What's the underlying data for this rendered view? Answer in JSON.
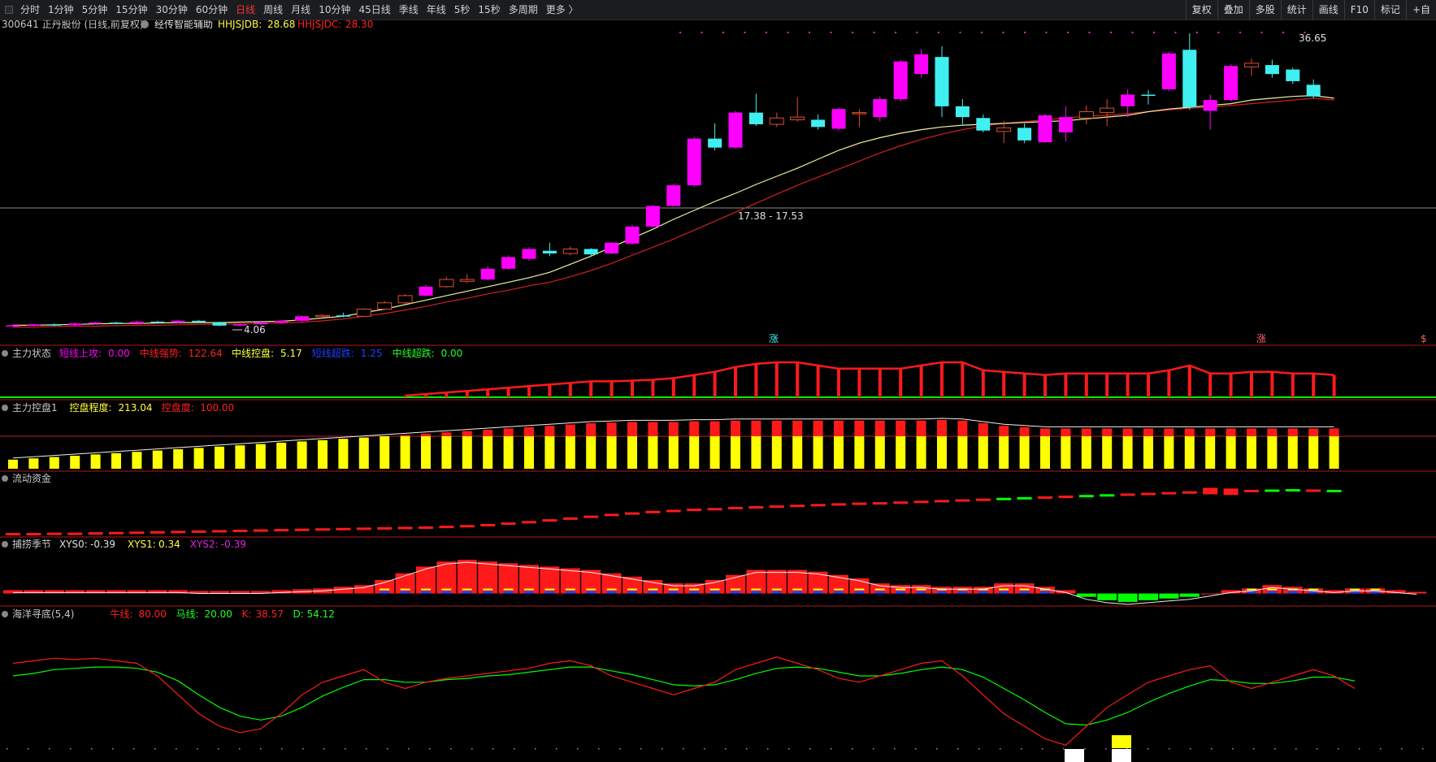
{
  "toolbar": {
    "periods": [
      "分时",
      "1分钟",
      "5分钟",
      "15分钟",
      "30分钟",
      "60分钟",
      "日线",
      "周线",
      "月线",
      "10分钟",
      "45日线",
      "季线",
      "年线",
      "5秒",
      "15秒",
      "多周期",
      "更多 〉"
    ],
    "active": "日线",
    "right_buttons": [
      "复权",
      "叠加",
      "多股",
      "统计",
      "画线",
      "F10",
      "标记",
      "+自"
    ]
  },
  "header": {
    "stock": "300641 正丹股份 (日线,前复权)",
    "indicator": "经传智能辅助",
    "hh_label": "HHJSJDB:",
    "hh_value": "28.68",
    "hc_label": "HHJSJDC:",
    "hc_value": "28.30"
  },
  "colors": {
    "up": "#ff00ff",
    "down": "#40f0f0",
    "ma1": "#f0f0a0",
    "ma2": "#d02020",
    "red": "#ff1a1a",
    "yellow": "#ffff00",
    "green": "#00ff00",
    "magenta": "#e020e0",
    "blue": "#2040ff",
    "white": "#ffffff"
  },
  "chart_data": [
    {
      "panel": "main",
      "type": "candlestick",
      "annotations": {
        "max_label": "36.65",
        "min_label": "4.06",
        "crosshair_label": "17.38 - 17.53",
        "markers": [
          "涨",
          "涨",
          "$"
        ]
      },
      "candles": [
        {
          "o": 4.0,
          "h": 4.2,
          "l": 3.9,
          "c": 4.1
        },
        {
          "o": 4.1,
          "h": 4.3,
          "l": 4.0,
          "c": 4.2
        },
        {
          "o": 4.2,
          "h": 4.3,
          "l": 4.0,
          "c": 4.1
        },
        {
          "o": 4.1,
          "h": 4.4,
          "l": 4.0,
          "c": 4.3
        },
        {
          "o": 4.3,
          "h": 4.5,
          "l": 4.2,
          "c": 4.4
        },
        {
          "o": 4.4,
          "h": 4.5,
          "l": 4.2,
          "c": 4.3
        },
        {
          "o": 4.3,
          "h": 4.6,
          "l": 4.2,
          "c": 4.5
        },
        {
          "o": 4.5,
          "h": 4.6,
          "l": 4.3,
          "c": 4.4
        },
        {
          "o": 4.4,
          "h": 4.7,
          "l": 4.3,
          "c": 4.6
        },
        {
          "o": 4.6,
          "h": 4.7,
          "l": 4.4,
          "c": 4.5
        },
        {
          "o": 4.4,
          "h": 4.5,
          "l": 4.0,
          "c": 4.06
        },
        {
          "o": 4.1,
          "h": 4.3,
          "l": 4.0,
          "c": 4.2
        },
        {
          "o": 4.2,
          "h": 4.5,
          "l": 4.1,
          "c": 4.4
        },
        {
          "o": 4.4,
          "h": 4.7,
          "l": 4.3,
          "c": 4.6
        },
        {
          "o": 4.6,
          "h": 5.2,
          "l": 4.5,
          "c": 5.1
        },
        {
          "o": 5.1,
          "h": 5.3,
          "l": 4.9,
          "c": 5.2
        },
        {
          "o": 5.2,
          "h": 5.5,
          "l": 5.0,
          "c": 5.1
        },
        {
          "o": 5.1,
          "h": 6.0,
          "l": 5.0,
          "c": 5.9
        },
        {
          "o": 5.9,
          "h": 6.8,
          "l": 5.8,
          "c": 6.6
        },
        {
          "o": 6.6,
          "h": 7.6,
          "l": 6.5,
          "c": 7.4
        },
        {
          "o": 7.4,
          "h": 8.6,
          "l": 7.3,
          "c": 8.4
        },
        {
          "o": 8.4,
          "h": 9.5,
          "l": 8.3,
          "c": 9.2
        },
        {
          "o": 9.0,
          "h": 9.8,
          "l": 8.8,
          "c": 9.2
        },
        {
          "o": 9.2,
          "h": 10.7,
          "l": 9.1,
          "c": 10.4
        },
        {
          "o": 10.4,
          "h": 11.9,
          "l": 10.3,
          "c": 11.7
        },
        {
          "o": 11.5,
          "h": 12.8,
          "l": 11.3,
          "c": 12.6
        },
        {
          "o": 12.4,
          "h": 13.3,
          "l": 11.8,
          "c": 12.1
        },
        {
          "o": 12.1,
          "h": 12.9,
          "l": 11.9,
          "c": 12.6
        },
        {
          "o": 12.6,
          "h": 12.7,
          "l": 11.8,
          "c": 12.0
        },
        {
          "o": 12.1,
          "h": 13.4,
          "l": 12.0,
          "c": 13.3
        },
        {
          "o": 13.2,
          "h": 15.3,
          "l": 13.1,
          "c": 15.1
        },
        {
          "o": 15.1,
          "h": 17.5,
          "l": 15.0,
          "c": 17.4
        },
        {
          "o": 17.4,
          "h": 19.9,
          "l": 17.3,
          "c": 19.7
        },
        {
          "o": 19.7,
          "h": 25.1,
          "l": 19.5,
          "c": 24.9
        },
        {
          "o": 24.9,
          "h": 26.6,
          "l": 23.6,
          "c": 23.9
        },
        {
          "o": 23.9,
          "h": 28.0,
          "l": 23.8,
          "c": 27.8
        },
        {
          "o": 27.8,
          "h": 29.9,
          "l": 26.3,
          "c": 26.5
        },
        {
          "o": 26.5,
          "h": 27.8,
          "l": 26.2,
          "c": 27.2
        },
        {
          "o": 27.0,
          "h": 29.5,
          "l": 26.8,
          "c": 27.3
        },
        {
          "o": 27.0,
          "h": 27.6,
          "l": 25.9,
          "c": 26.2
        },
        {
          "o": 26.0,
          "h": 28.4,
          "l": 25.8,
          "c": 28.2
        },
        {
          "o": 27.8,
          "h": 28.2,
          "l": 26.2,
          "c": 27.8
        },
        {
          "o": 27.3,
          "h": 29.6,
          "l": 26.8,
          "c": 29.3
        },
        {
          "o": 29.3,
          "h": 33.7,
          "l": 29.0,
          "c": 33.5
        },
        {
          "o": 32.1,
          "h": 34.9,
          "l": 31.7,
          "c": 34.3
        },
        {
          "o": 34.0,
          "h": 35.2,
          "l": 27.3,
          "c": 28.5
        },
        {
          "o": 28.5,
          "h": 29.3,
          "l": 26.5,
          "c": 27.3
        },
        {
          "o": 27.2,
          "h": 27.6,
          "l": 25.6,
          "c": 25.8
        },
        {
          "o": 25.7,
          "h": 26.9,
          "l": 24.4,
          "c": 26.1
        },
        {
          "o": 26.1,
          "h": 26.6,
          "l": 24.4,
          "c": 24.7
        },
        {
          "o": 24.5,
          "h": 27.7,
          "l": 24.4,
          "c": 27.5
        },
        {
          "o": 25.6,
          "h": 28.5,
          "l": 24.6,
          "c": 27.3
        },
        {
          "o": 27.2,
          "h": 28.6,
          "l": 26.5,
          "c": 27.9
        },
        {
          "o": 27.8,
          "h": 29.3,
          "l": 26.3,
          "c": 28.3
        },
        {
          "o": 28.5,
          "h": 30.4,
          "l": 27.3,
          "c": 29.8
        },
        {
          "o": 29.8,
          "h": 30.3,
          "l": 28.7,
          "c": 29.7
        },
        {
          "o": 30.4,
          "h": 34.6,
          "l": 30.2,
          "c": 34.4
        },
        {
          "o": 34.8,
          "h": 36.65,
          "l": 28.1,
          "c": 28.4
        },
        {
          "o": 28.0,
          "h": 29.8,
          "l": 25.9,
          "c": 29.2
        },
        {
          "o": 29.2,
          "h": 33.2,
          "l": 29.0,
          "c": 33.0
        },
        {
          "o": 32.9,
          "h": 33.8,
          "l": 31.9,
          "c": 33.3
        },
        {
          "o": 33.1,
          "h": 33.7,
          "l": 31.7,
          "c": 32.1
        },
        {
          "o": 32.6,
          "h": 32.8,
          "l": 31.0,
          "c": 31.3
        },
        {
          "o": 30.9,
          "h": 31.5,
          "l": 29.4,
          "c": 29.6
        }
      ],
      "ma1": [
        4.1,
        4.1,
        4.15,
        4.2,
        4.25,
        4.3,
        4.3,
        4.35,
        4.4,
        4.4,
        4.4,
        4.45,
        4.5,
        4.55,
        4.7,
        4.9,
        5.1,
        5.5,
        5.9,
        6.4,
        6.9,
        7.4,
        7.9,
        8.4,
        8.9,
        9.4,
        10.0,
        10.9,
        11.8,
        12.8,
        13.8,
        14.8,
        15.9,
        16.9,
        17.9,
        18.8,
        19.8,
        20.7,
        21.6,
        22.6,
        23.6,
        24.4,
        25.0,
        25.5,
        25.9,
        26.2,
        26.4,
        26.5,
        26.6,
        26.7,
        26.8,
        26.9,
        27.1,
        27.3,
        27.5,
        27.9,
        28.2,
        28.4,
        28.6,
        28.8,
        29.2,
        29.4,
        29.6,
        29.7,
        29.4
      ],
      "ma2": [
        3.9,
        3.9,
        3.95,
        4.0,
        4.0,
        4.05,
        4.1,
        4.1,
        4.15,
        4.2,
        4.2,
        4.25,
        4.3,
        4.35,
        4.45,
        4.6,
        4.8,
        5.1,
        5.4,
        5.8,
        6.2,
        6.7,
        7.1,
        7.6,
        8.0,
        8.5,
        8.9,
        9.5,
        10.2,
        11.0,
        11.9,
        12.8,
        13.7,
        14.7,
        15.7,
        16.7,
        17.7,
        18.7,
        19.7,
        20.6,
        21.5,
        22.4,
        23.3,
        24.1,
        24.8,
        25.4,
        25.9,
        26.3,
        26.6,
        26.8,
        27.0,
        27.2,
        27.4,
        27.5,
        27.7,
        27.9,
        28.1,
        28.3,
        28.4,
        28.6,
        28.8,
        29.0,
        29.2,
        29.4,
        29.2
      ]
    },
    {
      "panel": "zhuli_zhuangtai",
      "title": "主力状态",
      "legend": [
        {
          "name": "短线上攻:",
          "value": "0.00",
          "color": "#ff00ff"
        },
        {
          "name": "中线强势:",
          "value": "122.64",
          "color": "#ff2020"
        },
        {
          "name": "中线控盘:",
          "value": "5.17",
          "color": "#ffff40"
        },
        {
          "name": "短线超跌:",
          "value": "1.25",
          "color": "#2040ff"
        },
        {
          "name": "中线超跌:",
          "value": "0.00",
          "color": "#20ff20"
        }
      ],
      "bars": [
        0,
        0,
        0,
        0,
        0,
        0,
        0,
        0,
        0,
        0,
        0,
        0,
        0,
        0,
        0,
        0,
        0,
        0,
        0,
        2,
        4,
        6,
        8,
        10,
        12,
        14,
        16,
        18,
        20,
        20,
        21,
        22,
        24,
        28,
        32,
        38,
        42,
        44,
        44,
        40,
        36,
        36,
        36,
        36,
        40,
        44,
        44,
        34,
        32,
        30,
        28,
        30,
        30,
        30,
        30,
        30,
        34,
        40,
        30,
        30,
        32,
        32,
        30,
        30,
        28
      ],
      "bars_max": 45
    },
    {
      "panel": "zhuli_kongpan",
      "title": "主力控盘1",
      "legend": [
        {
          "name": "控盘程度:",
          "value": "213.04",
          "color": "#ffff40"
        },
        {
          "name": "控盘度:",
          "value": "100.00",
          "color": "#ff2020"
        }
      ],
      "levels": [
        14,
        16,
        18,
        20,
        22,
        24,
        26,
        28,
        30,
        32,
        34,
        36,
        38,
        40,
        42,
        44,
        46,
        48,
        50,
        52,
        54,
        56,
        58,
        60,
        62,
        64,
        66,
        68,
        70,
        71,
        72,
        72,
        72,
        73,
        73,
        74,
        74,
        74,
        74,
        74,
        74,
        74,
        74,
        74,
        74,
        75,
        74,
        70,
        66,
        64,
        62,
        62,
        62,
        62,
        62,
        62,
        62,
        62,
        62,
        62,
        62,
        62,
        62,
        62,
        62
      ],
      "threshold": 50,
      "max": 80
    },
    {
      "panel": "liudong_zijin",
      "title": "流动资金",
      "values": [
        0.1,
        0.1,
        0.2,
        0.2,
        0.3,
        0.4,
        0.5,
        0.6,
        0.7,
        0.8,
        0.9,
        1.0,
        1.1,
        1.2,
        1.3,
        1.4,
        1.5,
        1.6,
        1.7,
        1.8,
        1.9,
        2.1,
        2.3,
        2.6,
        3.0,
        3.4,
        3.9,
        4.4,
        4.9,
        5.4,
        5.8,
        6.2,
        6.5,
        6.8,
        7.0,
        7.3,
        7.5,
        7.7,
        7.9,
        8.1,
        8.3,
        8.5,
        8.6,
        8.8,
        9.0,
        9.2,
        9.4,
        9.6,
        9.8,
        10.0,
        10.2,
        10.4,
        10.6,
        10.8,
        11.0,
        11.2,
        11.4,
        11.6,
        12.0,
        11.8,
        12.0,
        12.1,
        12.2,
        12.1,
        12.0
      ],
      "green_bars": [
        48,
        49,
        52,
        53,
        61,
        62,
        64
      ],
      "max": 13
    },
    {
      "panel": "bulao_jijie",
      "title": "捕捞季节",
      "legend": [
        {
          "name": "XYS0:",
          "value": "-0.39",
          "color": "#e0e0e0"
        },
        {
          "name": "XYS1:",
          "value": "0.34",
          "color": "#ffff40"
        },
        {
          "name": "XYS2:",
          "value": "-0.39",
          "color": "#e020e0"
        }
      ],
      "values": [
        0.2,
        0.2,
        0.2,
        0.2,
        0.2,
        0.2,
        0.2,
        0.2,
        0.2,
        0.15,
        0.15,
        0.15,
        0.15,
        0.2,
        0.25,
        0.3,
        0.4,
        0.5,
        0.8,
        1.2,
        1.6,
        1.9,
        2.0,
        1.9,
        1.8,
        1.7,
        1.6,
        1.5,
        1.4,
        1.2,
        1.0,
        0.8,
        0.6,
        0.6,
        0.8,
        1.1,
        1.4,
        1.4,
        1.4,
        1.3,
        1.1,
        0.9,
        0.6,
        0.5,
        0.5,
        0.4,
        0.4,
        0.4,
        0.6,
        0.6,
        0.4,
        0.2,
        -0.2,
        -0.4,
        -0.5,
        -0.4,
        -0.3,
        -0.2,
        0.0,
        0.2,
        0.3,
        0.5,
        0.4,
        0.3,
        0.2,
        0.3,
        0.3,
        0.2,
        0.1
      ],
      "min": -0.6,
      "max": 2.2
    },
    {
      "panel": "haiyang_xundi",
      "title": "海洋寻底(5,4)",
      "legend": [
        {
          "name": "牛线:",
          "value": "80.00",
          "color": "#ff2020"
        },
        {
          "name": "马线:",
          "value": "20.00",
          "color": "#20ff20"
        },
        {
          "name": "K:",
          "value": "38.57",
          "color": "#ff2020"
        },
        {
          "name": "D:",
          "value": "54.12",
          "color": "#20ff20"
        }
      ],
      "k": [
        70,
        72,
        74,
        73,
        74,
        72,
        70,
        60,
        45,
        30,
        20,
        15,
        18,
        30,
        45,
        55,
        60,
        65,
        55,
        50,
        55,
        58,
        60,
        62,
        64,
        66,
        70,
        72,
        68,
        60,
        55,
        50,
        45,
        50,
        55,
        65,
        70,
        75,
        70,
        65,
        58,
        55,
        60,
        65,
        70,
        72,
        60,
        45,
        30,
        20,
        10,
        5,
        20,
        35,
        45,
        55,
        60,
        65,
        68,
        55,
        50,
        55,
        60,
        65,
        60,
        50
      ],
      "d": [
        60,
        62,
        65,
        66,
        67,
        67,
        66,
        63,
        56,
        45,
        35,
        28,
        25,
        28,
        35,
        44,
        51,
        57,
        57,
        55,
        55,
        57,
        58,
        60,
        61,
        63,
        65,
        67,
        67,
        64,
        61,
        57,
        53,
        52,
        53,
        57,
        62,
        66,
        67,
        66,
        63,
        60,
        60,
        62,
        65,
        67,
        65,
        59,
        50,
        41,
        31,
        22,
        21,
        25,
        31,
        39,
        46,
        52,
        57,
        56,
        54,
        54,
        56,
        59,
        59,
        56
      ]
    }
  ]
}
